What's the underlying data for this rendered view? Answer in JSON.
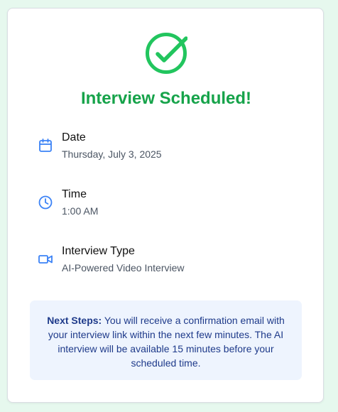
{
  "colors": {
    "page_background": "#e6f8ee",
    "success_green": "#16a34a",
    "icon_blue": "#3b82f6",
    "note_background": "#eef4fe",
    "note_text": "#1e3a8a"
  },
  "header": {
    "icon": "check-circle-icon",
    "title": "Interview Scheduled!"
  },
  "details": [
    {
      "icon": "calendar-icon",
      "label": "Date",
      "value": "Thursday, July 3, 2025"
    },
    {
      "icon": "clock-icon",
      "label": "Time",
      "value": "1:00 AM"
    },
    {
      "icon": "video-icon",
      "label": "Interview Type",
      "value": "AI-Powered Video Interview"
    }
  ],
  "next_steps": {
    "heading": "Next Steps:",
    "body": "You will receive a confirmation email with your interview link within the next few minutes. The AI interview will be available 15 minutes before your scheduled time."
  }
}
